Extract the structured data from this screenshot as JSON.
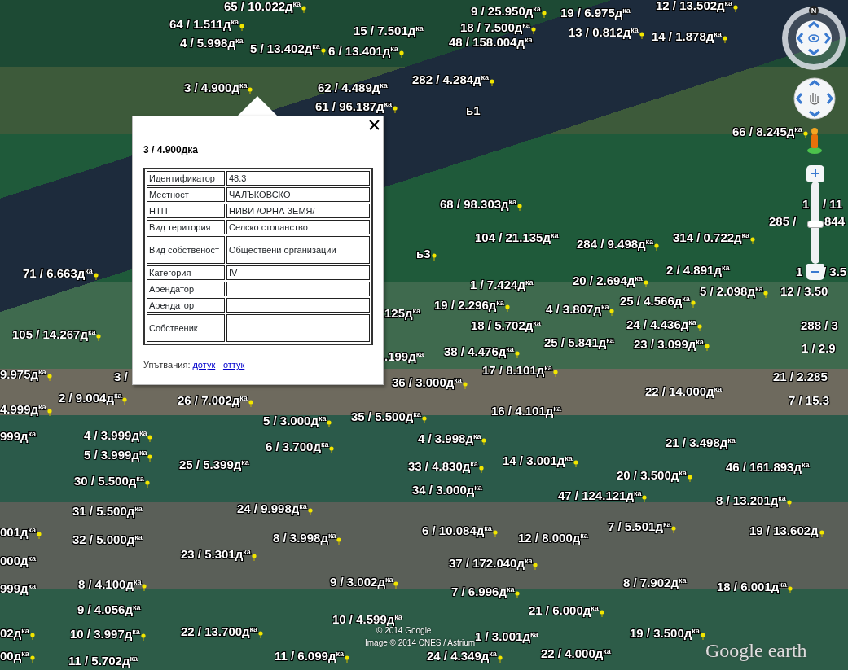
{
  "map": {
    "labels": [
      {
        "text": "65 / 10.022д$^{ка}$"
      },
      {
        "text": "9 / 25.950д$^{ка}$"
      },
      {
        "text": "19 / 6.975д$^{ка}$"
      },
      {
        "text": "12 / 13.502д$^{ка}$"
      },
      {
        "text": "64 / 1.511д$^{ка}$"
      },
      {
        "text": "15 / 7.501д$^{ка}$"
      },
      {
        "text": "18 / 7.500д$^{ка}$"
      },
      {
        "text": "13 / 0.812д$^{ка}$"
      },
      {
        "text": "4 / 5.998д$^{ка}$"
      },
      {
        "text": "5 / 13.402д$^{ка}$"
      },
      {
        "text": "6 / 13.401д$^{ка}$"
      },
      {
        "text": "48 / 158.004д$^{ка}$"
      },
      {
        "text": "14 / 1.878д$^{ка}$"
      },
      {
        "text": "3 / 4.900д$^{ка}$"
      },
      {
        "text": "62 / 4.489д$^{ка}$"
      },
      {
        "text": "282 / 4.284д$^{ка}$"
      },
      {
        "text": "61 / 96.187д$^{ка}$"
      },
      {
        "text": "ь1"
      },
      {
        "text": "66 / 8.245д$^{ка}$"
      },
      {
        "text": "68 / 98.303д$^{ка}$"
      },
      {
        "text": "1"
      },
      {
        "text": "/ 11"
      },
      {
        "text": "285 /"
      },
      {
        "text": "844"
      },
      {
        "text": "71 / 6.663д$^{ка}$"
      },
      {
        "text": "ь3"
      },
      {
        "text": "104 / 21.135д$^{ка}$"
      },
      {
        "text": "284 / 9.498д$^{ка}$"
      },
      {
        "text": "314 / 0.722д$^{ка}$"
      },
      {
        "text": "2 / 4.891д$^{ка}$"
      },
      {
        "text": "1"
      },
      {
        "text": "/ 3.5"
      },
      {
        "text": "1 / 7.424д$^{ка}$"
      },
      {
        "text": "20 / 2.694д$^{ка}$"
      },
      {
        "text": "5 / 2.098д$^{ка}$"
      },
      {
        "text": "12 / 3.50"
      },
      {
        "text": "25 / 4.566д$^{ка}$"
      },
      {
        "text": "19 / 2.296д$^{ка}$"
      },
      {
        "text": "125д$^{ка}$"
      },
      {
        "text": "4 / 3.807д$^{ка}$"
      },
      {
        "text": "105 / 14.267д$^{ка}$"
      },
      {
        "text": "18 / 5.702д$^{ка}$"
      },
      {
        "text": "24 / 4.436д$^{ка}$"
      },
      {
        "text": "288 / 3"
      },
      {
        "text": "25 / 5.841д$^{ка}$"
      },
      {
        "text": "23 / 3.099д$^{ка}$"
      },
      {
        "text": "1 / 2.9"
      },
      {
        "text": ".199д$^{ка}$"
      },
      {
        "text": "38 / 4.476д$^{ка}$"
      },
      {
        "text": "9.975д$^{ка}$"
      },
      {
        "text": "3 /"
      },
      {
        "text": "36 / 3.000д$^{ка}$"
      },
      {
        "text": "17 / 8.101д$^{ка}$"
      },
      {
        "text": "22 / 14.000д$^{ка}$"
      },
      {
        "text": "21 / 2.285"
      },
      {
        "text": "2 / 9.004д$^{ка}$"
      },
      {
        "text": "7 / 15.3"
      },
      {
        "text": "4.999д$^{ка}$"
      },
      {
        "text": "26 / 7.002д$^{ка}$"
      },
      {
        "text": "16 / 4.101д$^{ка}$"
      },
      {
        "text": "5 / 3.000д$^{ка}$"
      },
      {
        "text": "35 / 5.500д$^{ка}$"
      },
      {
        "text": "999д$^{ка}$"
      },
      {
        "text": "4 / 3.999д$^{ка}$"
      },
      {
        "text": "4 / 3.998д$^{ка}$"
      },
      {
        "text": "21 / 3.498д$^{ка}$"
      },
      {
        "text": "6 / 3.700д$^{ка}$"
      },
      {
        "text": "5 / 3.999д$^{ка}$"
      },
      {
        "text": "25 / 5.399д$^{ка}$"
      },
      {
        "text": "33 / 4.830д$^{ка}$"
      },
      {
        "text": "14 / 3.001д$^{ка}$"
      },
      {
        "text": "46 / 161.893д$^{ка}$"
      },
      {
        "text": "20 / 3.500д$^{ка}$"
      },
      {
        "text": "30 / 5.500д$^{ка}$"
      },
      {
        "text": "34 / 3.000д$^{ка}$"
      },
      {
        "text": "47 / 124.121д$^{ка}$"
      },
      {
        "text": "8 / 13.201д$^{ка}$"
      },
      {
        "text": "31 / 5.500д$^{ка}$"
      },
      {
        "text": "24 / 9.998д$^{ка}$"
      },
      {
        "text": "001д$^{ка}$"
      },
      {
        "text": "32 / 5.000д$^{ка}$"
      },
      {
        "text": "8 / 3.998д$^{ка}$"
      },
      {
        "text": "6 / 10.084д$^{ка}$"
      },
      {
        "text": "12 / 8.000д$^{ка}$"
      },
      {
        "text": "7 / 5.501д$^{ка}$"
      },
      {
        "text": "19 / 13.602д"
      },
      {
        "text": "000д$^{ка}$"
      },
      {
        "text": "23 / 5.301д$^{ка}$"
      },
      {
        "text": "37 / 172.040д$^{ка}$"
      },
      {
        "text": "999д$^{ка}$"
      },
      {
        "text": "8 / 4.100д$^{ка}$"
      },
      {
        "text": "9 / 3.002д$^{ка}$"
      },
      {
        "text": "8 / 7.902д$^{ка}$"
      },
      {
        "text": "18 / 6.001д$^{ка}$"
      },
      {
        "text": "7 / 6.996д$^{ка}$"
      },
      {
        "text": "9 / 4.056д$^{ка}$"
      },
      {
        "text": "21 / 6.000д$^{ка}$"
      },
      {
        "text": "02д$^{ка}$"
      },
      {
        "text": "10 / 4.599д$^{ка}$"
      },
      {
        "text": "10 / 3.997д$^{ка}$"
      },
      {
        "text": "22 / 13.700д$^{ка}$"
      },
      {
        "text": "1 / 3.001д$^{ка}$"
      },
      {
        "text": "19 / 3.500д$^{ка}$"
      },
      {
        "text": "00д$^{ка}$"
      },
      {
        "text": "11 / 5.702д$^{ка}$"
      },
      {
        "text": "11 / 6.099д$^{ка}$"
      },
      {
        "text": "24 / 4.349д$^{ка}$"
      },
      {
        "text": "22 / 4.000д$^{ка}$"
      }
    ],
    "attribution": [
      "© 2014 Google",
      "Image © 2014 CNES / Astrium"
    ],
    "logo": "Google earth"
  },
  "navigation": {
    "compass": {
      "north": "N"
    },
    "zoom_slider": {
      "level": 0.51
    }
  },
  "popup": {
    "title": "3 / 4.900дка",
    "rows": [
      {
        "label": "Идентификатор",
        "value": "48.3"
      },
      {
        "label": "Местност",
        "value": "ЧАЛЪКОВСКО"
      },
      {
        "label": "НТП",
        "value": "НИВИ /ОРНА ЗЕМЯ/"
      },
      {
        "label": "Вид територия",
        "value": "Селско стопанство"
      },
      {
        "label": "Вид собственост",
        "value": "Обществени организации",
        "tall": true
      },
      {
        "label": "Категория",
        "value": "IV"
      },
      {
        "label": "Арендатор"
      },
      {
        "label": "Арендатор"
      },
      {
        "label": "Собственик",
        "tall": true
      }
    ],
    "directions": {
      "label": "Упътвания:",
      "links": [
        "дотук",
        "оттук"
      ],
      "separator": "-"
    }
  }
}
